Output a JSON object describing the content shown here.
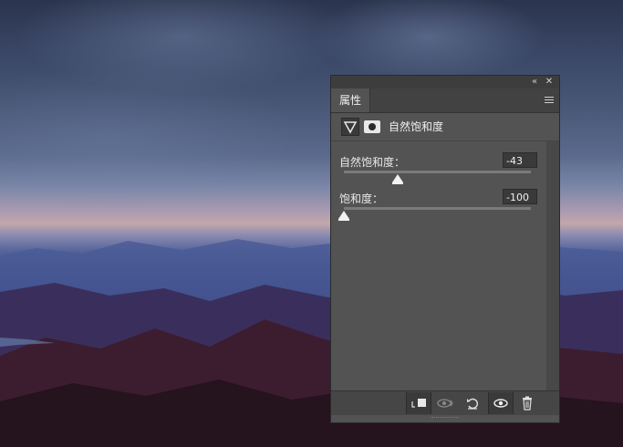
{
  "panel": {
    "collapse_icon": "double-chevron-left-icon",
    "close_icon": "close-icon",
    "tab_label": "属性",
    "menu_icon": "panel-menu-icon",
    "adjustment_icon": "vibrance-triangle-icon",
    "mask_icon": "layer-mask-icon",
    "adjustment_title": "自然饱和度"
  },
  "fields": [
    {
      "label": "自然饱和度：",
      "value": "-43",
      "slider_fraction": 0.29
    },
    {
      "label": "饱和度：",
      "value": "-100",
      "slider_fraction": 0.0
    }
  ],
  "bottom_buttons": [
    {
      "name": "clip-to-layer-button",
      "icon": "clip-icon",
      "glyph": "⬚",
      "state": "active"
    },
    {
      "name": "view-previous-state-button",
      "icon": "eye-previous-icon",
      "glyph": "◉",
      "state": "dim"
    },
    {
      "name": "reset-button",
      "icon": "reset-icon",
      "glyph": "↺",
      "state": "normal"
    },
    {
      "name": "toggle-visibility-button",
      "icon": "eye-icon",
      "glyph": "👁",
      "state": "active"
    },
    {
      "name": "delete-button",
      "icon": "trash-icon",
      "glyph": "🗑",
      "state": "normal"
    }
  ]
}
